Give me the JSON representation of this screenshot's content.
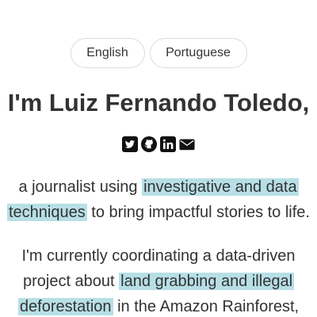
{
  "language_switcher": {
    "english_label": "English",
    "portuguese_label": "Portuguese"
  },
  "header": {
    "title": "I'm Luiz Fernando Toledo,"
  },
  "social_icons": [
    "twitter-icon",
    "github-icon",
    "linkedin-icon",
    "envelope-icon"
  ],
  "intro": {
    "p1_pre": "a journalist using ",
    "p1_hl_line1": "investigative and data",
    "p1_hl_line2": "techniques",
    "p1_post": " to bring impactful stories to life.",
    "p2_pre": "I'm currently coordinating a data-driven project about ",
    "p2_hl_line1": "land grabbing and illegal",
    "p2_hl_line2": "deforestation",
    "p2_post": " in the Amazon Rainforest,"
  },
  "colors": {
    "text": "#333333",
    "highlight": "#b7dfe6",
    "icon": "#111111",
    "button_border": "#dcdcdc"
  }
}
